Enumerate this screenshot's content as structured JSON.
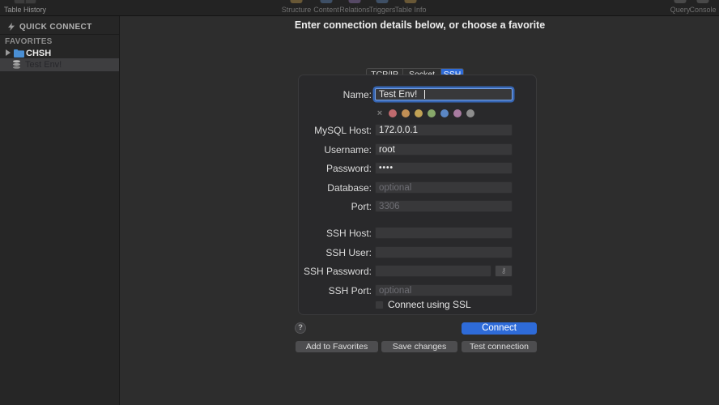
{
  "toolbar": {
    "history_label": "Table History",
    "items": [
      {
        "label": "Structure",
        "color": "#b08d4a"
      },
      {
        "label": "Content",
        "color": "#5a7ca8"
      },
      {
        "label": "Relations",
        "color": "#8a6fa8"
      },
      {
        "label": "Triggers",
        "color": "#5a7ca8"
      },
      {
        "label": "Table Info",
        "color": "#b08d4a"
      }
    ],
    "right_items": [
      {
        "label": "Query",
        "color": "#6f6f6f"
      },
      {
        "label": "Console",
        "color": "#6f6f6f"
      }
    ]
  },
  "sidebar": {
    "quick_connect_label": "QUICK CONNECT",
    "favorites_header": "FAVORITES",
    "folder_label": "CHSH",
    "selected_favorite_label": "Test Env!"
  },
  "main": {
    "header": "Enter connection details below, or choose a favorite",
    "tabs": [
      {
        "label": "TCP/IP"
      },
      {
        "label": "Socket"
      },
      {
        "label": "SSH"
      }
    ],
    "accent_color": "#2e6bd8",
    "form": {
      "name": {
        "label": "Name:",
        "value": "Test Env!"
      },
      "colors": {
        "clear": "×",
        "swatches": [
          "#c06a6e",
          "#c28f55",
          "#c2a355",
          "#87a86a",
          "#5b87c5",
          "#a87ba0",
          "#8e8e8e"
        ]
      },
      "mysql_host": {
        "label": "MySQL Host:",
        "value": "172.0.0.1"
      },
      "username": {
        "label": "Username:",
        "value": "root"
      },
      "password": {
        "label": "Password:",
        "value": "••••"
      },
      "database": {
        "label": "Database:",
        "placeholder": "optional"
      },
      "port": {
        "label": "Port:",
        "placeholder": "3306"
      },
      "ssh_host": {
        "label": "SSH Host:"
      },
      "ssh_user": {
        "label": "SSH User:"
      },
      "ssh_password": {
        "label": "SSH Password:"
      },
      "ssh_port": {
        "label": "SSH Port:",
        "placeholder": "optional"
      },
      "ssl_checkbox": {
        "label": "Connect using SSL",
        "checked": false
      }
    },
    "help_label": "?",
    "connect_label": "Connect",
    "footer_buttons": [
      {
        "label": "Add to Favorites"
      },
      {
        "label": "Save changes"
      },
      {
        "label": "Test connection"
      }
    ]
  }
}
